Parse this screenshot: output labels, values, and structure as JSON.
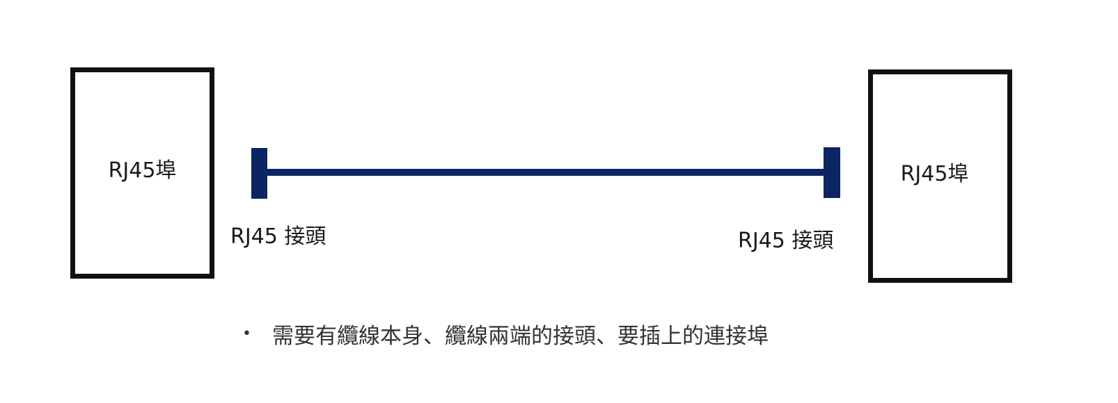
{
  "colors": {
    "cable": "#0c2461",
    "box_border": "#111111"
  },
  "port_left": {
    "label": "RJ45埠"
  },
  "port_right": {
    "label": "RJ45埠"
  },
  "connector_left": {
    "label": "RJ45 接頭"
  },
  "connector_right": {
    "label": "RJ45 接頭"
  },
  "bullet": {
    "text": "需要有纜線本身、纜線兩端的接頭、要插上的連接埠"
  }
}
